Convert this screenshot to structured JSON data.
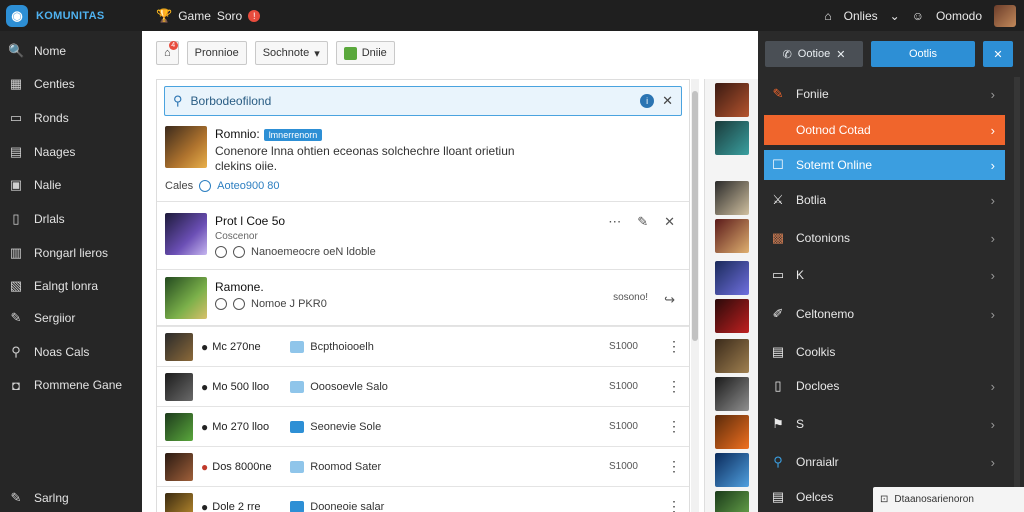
{
  "app": {
    "logo_text": "KOMUNITAS"
  },
  "topbar": {
    "game_label": "Game",
    "game_sub": "Soro",
    "online_label": "Onlies",
    "user_label": "Oomodo",
    "badge": "!"
  },
  "sidebar": {
    "items": [
      {
        "label": "Nome",
        "icon": "search-icon"
      },
      {
        "label": "Centies",
        "icon": "grid-icon"
      },
      {
        "label": "Ronds",
        "icon": "inbox-icon"
      },
      {
        "label": "Naages",
        "icon": "page-icon"
      },
      {
        "label": "Nalie",
        "icon": "image-icon"
      },
      {
        "label": "Drlals",
        "icon": "doc-icon"
      },
      {
        "label": "Rongarl lieros",
        "icon": "stack-icon"
      },
      {
        "label": "Ealngt lonra",
        "icon": "folder-icon"
      },
      {
        "label": "Sergiior",
        "icon": "pencil-icon"
      },
      {
        "label": "Noas Cals",
        "icon": "pin-icon"
      },
      {
        "label": "Rommene Gane",
        "icon": "gamepad-icon"
      }
    ],
    "footer_label": "Sarlng"
  },
  "toolbar": {
    "home_badge": "4",
    "filter_label": "Pronnioe",
    "select_label": "Sochnote",
    "action_label": "Dniie"
  },
  "search": {
    "value": "Borbodeofilond"
  },
  "posts": [
    {
      "title": "Romnio:",
      "tag": "lmnerrenorn",
      "text": "Conenore lnna ohtien eceonas solchechre lloant orietiun clekins oiie.",
      "meta_label": "Cales",
      "meta_link": "Aoteo900 80"
    },
    {
      "title": "Prot l Coe 5o",
      "subtitle": "Coscenor",
      "meta": "Nanoemeocre oeN ldoble"
    },
    {
      "title": "Ramone.",
      "meta": "Nomoe J PKR0",
      "count": "sosono!"
    }
  ],
  "rows": [
    {
      "name": "Mc 270ne",
      "desc": "Bcpthoiooelh",
      "num": "S1000"
    },
    {
      "name": "Mo 500 lloo",
      "desc": "Ooosoevle Salo",
      "num": "S1000"
    },
    {
      "name": "Mo 270 lloo",
      "desc": "Seonevie Sole",
      "num": "S1000"
    },
    {
      "name": "Dos 8000ne",
      "desc": "Roomod Sater",
      "num": "S1000"
    },
    {
      "name": "Dole 2 rre",
      "desc": "Dooneoie salar",
      "num": ""
    }
  ],
  "right": {
    "tab_a": "Ootioe",
    "tab_b": "Ootlis",
    "items": [
      {
        "label": "Foniie",
        "icon": "pencil-icon"
      },
      {
        "label": "Ootnod Cotad",
        "icon": "",
        "style": "orange"
      },
      {
        "label": "Sotemt Online",
        "icon": "chat-icon",
        "style": "blue"
      },
      {
        "label": "Botlia",
        "icon": "sword-icon"
      },
      {
        "label": "Cotonions",
        "icon": "box-icon"
      },
      {
        "label": "K",
        "icon": "card-icon"
      },
      {
        "label": "Celtonemo",
        "icon": "tool-icon"
      },
      {
        "label": "Coolkis",
        "icon": "doc-icon"
      },
      {
        "label": "Docloes",
        "icon": "note-icon"
      },
      {
        "label": "S",
        "icon": "tag-icon"
      },
      {
        "label": "Onraialr",
        "icon": "search-icon"
      },
      {
        "label": "Oelces",
        "icon": "doc-icon"
      }
    ],
    "toast": "Dtaanosarienoron"
  },
  "colors": {
    "accent": "#2d8fd5",
    "orange": "#f0652c",
    "sidebar": "#262626"
  }
}
